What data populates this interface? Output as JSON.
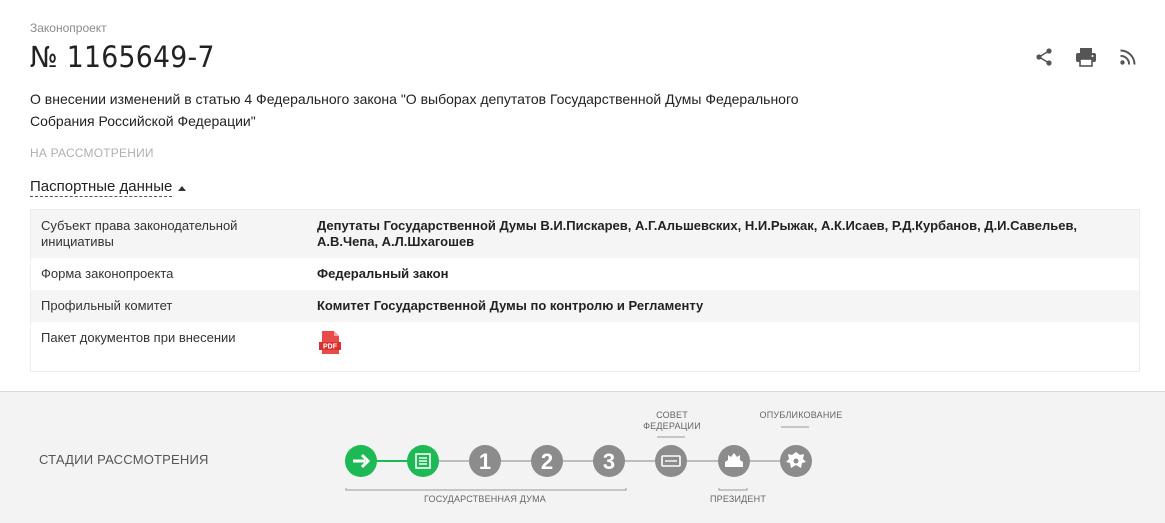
{
  "header": {
    "overline": "Законопроект",
    "number": "№ 1165649-7",
    "title": "О внесении изменений в статью 4 Федерального закона \"О выборах депутатов Государственной Думы Федерального Собрания Российской Федерации\"",
    "status": "НА РАССМОТРЕНИИ"
  },
  "actions": [
    {
      "icon": "share-icon"
    },
    {
      "icon": "print-icon"
    },
    {
      "icon": "rss-icon"
    }
  ],
  "passport": {
    "toggle_label": "Паспортные данные",
    "rows": [
      {
        "key": "Субъект права законодательной инициативы",
        "value": "Депутаты Государственной Думы В.И.Пискарев, А.Г.Альшевских, Н.И.Рыжак, А.К.Исаев, Р.Д.Курбанов, Д.И.Савельев, А.В.Чепа, А.Л.Шхагошев"
      },
      {
        "key": "Форма законопроекта",
        "value": "Федеральный закон"
      },
      {
        "key": "Профильный комитет",
        "value": "Комитет Государственной Думы по контролю и Регламенту"
      },
      {
        "key": "Пакет документов при внесении",
        "value": "",
        "file_icon": "pdf-icon",
        "file_label": "PDF"
      }
    ]
  },
  "stages": {
    "label": "СТАДИИ РАССМОТРЕНИЯ",
    "steps": [
      {
        "icon": "arrow-right-icon",
        "state": "done"
      },
      {
        "icon": "document-list-icon",
        "state": "current"
      },
      {
        "label": "1",
        "state": "pending"
      },
      {
        "label": "2",
        "state": "pending"
      },
      {
        "label": "3",
        "state": "pending"
      },
      {
        "icon": "federation-council-icon",
        "state": "pending"
      },
      {
        "icon": "president-icon",
        "state": "pending"
      },
      {
        "icon": "emblem-icon",
        "state": "pending"
      }
    ],
    "captions": {
      "duma": "ГОСУДАРСТВЕННАЯ ДУМА",
      "council": "СОВЕТ ФЕДЕРАЦИИ",
      "president": "ПРЕЗИДЕНТ",
      "published": "ОПУБЛИКОВАНИЕ"
    },
    "colors": {
      "done": "#1db954",
      "pending": "#8c8c8c",
      "line_done": "#1db954",
      "line_pending": "#bdbdbd"
    }
  }
}
